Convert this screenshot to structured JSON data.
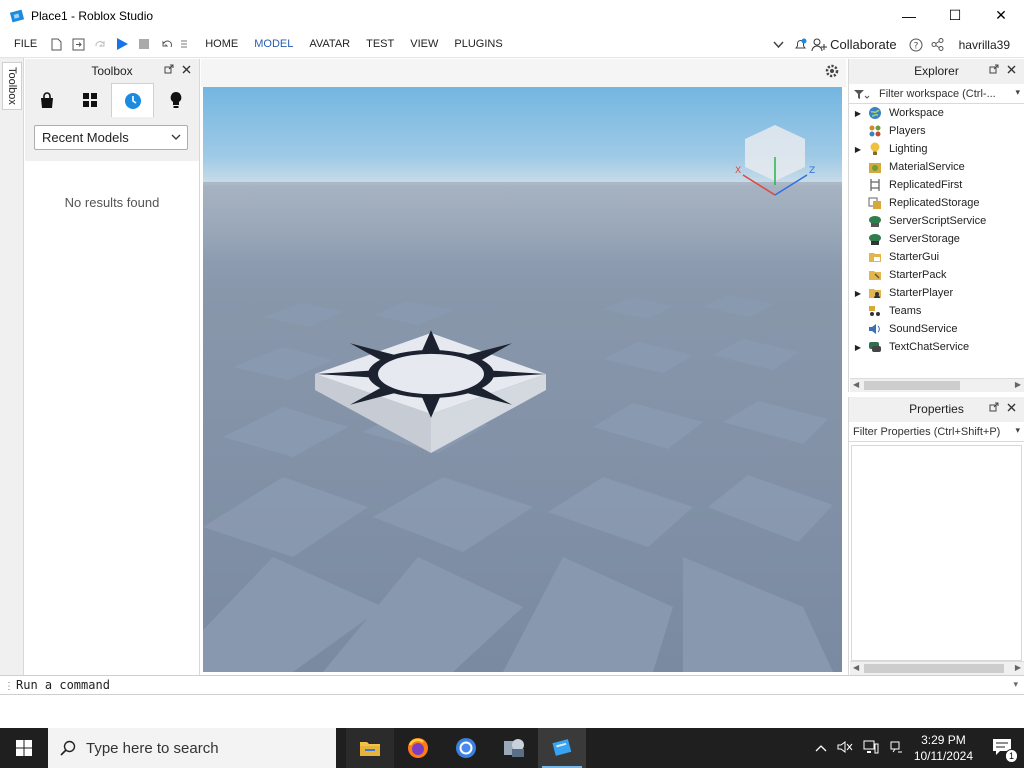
{
  "window": {
    "title": "Place1 - Roblox Studio",
    "minimize_glyph": "—",
    "maximize_glyph": "☐",
    "close_glyph": "✕"
  },
  "menubar": {
    "file": "FILE",
    "tabs": [
      "HOME",
      "MODEL",
      "AVATAR",
      "TEST",
      "VIEW",
      "PLUGINS"
    ],
    "active_tab": "MODEL",
    "collaborate": "Collaborate",
    "user": "havrilla39"
  },
  "left_strip": {
    "tab_label": "Toolbox"
  },
  "toolbox": {
    "title": "Toolbox",
    "tabs": [
      "marketplace",
      "inventory",
      "recent",
      "creations"
    ],
    "selected_tab": "recent",
    "dropdown_value": "Recent Models",
    "empty_message": "No results found"
  },
  "explorer": {
    "title": "Explorer",
    "filter_placeholder": "Filter workspace (Ctrl-...",
    "items": [
      {
        "label": "Workspace",
        "expandable": true,
        "icon": "workspace-icon",
        "color": "#3b82c4"
      },
      {
        "label": "Players",
        "expandable": false,
        "icon": "players-icon",
        "color": "#d08a2a"
      },
      {
        "label": "Lighting",
        "expandable": true,
        "icon": "lighting-icon",
        "color": "#e0b030"
      },
      {
        "label": "MaterialService",
        "expandable": false,
        "icon": "material-service-icon",
        "color": "#c98b2e"
      },
      {
        "label": "ReplicatedFirst",
        "expandable": false,
        "icon": "replicated-first-icon",
        "color": "#777777"
      },
      {
        "label": "ReplicatedStorage",
        "expandable": false,
        "icon": "replicated-storage-icon",
        "color": "#b8742a"
      },
      {
        "label": "ServerScriptService",
        "expandable": false,
        "icon": "server-script-service-icon",
        "color": "#2f7d4e"
      },
      {
        "label": "ServerStorage",
        "expandable": false,
        "icon": "server-storage-icon",
        "color": "#2f7d4e"
      },
      {
        "label": "StarterGui",
        "expandable": false,
        "icon": "starter-gui-icon",
        "color": "#d7a83a"
      },
      {
        "label": "StarterPack",
        "expandable": false,
        "icon": "starter-pack-icon",
        "color": "#d7a83a"
      },
      {
        "label": "StarterPlayer",
        "expandable": true,
        "icon": "starter-player-icon",
        "color": "#d7a83a"
      },
      {
        "label": "Teams",
        "expandable": false,
        "icon": "teams-icon",
        "color": "#c07a2a"
      },
      {
        "label": "SoundService",
        "expandable": false,
        "icon": "sound-service-icon",
        "color": "#3b6fb6"
      },
      {
        "label": "TextChatService",
        "expandable": true,
        "icon": "text-chat-service-icon",
        "color": "#2f6f4e"
      }
    ]
  },
  "properties": {
    "title": "Properties",
    "filter_placeholder": "Filter Properties (Ctrl+Shift+P)"
  },
  "command_bar": {
    "placeholder": "Run a command"
  },
  "taskbar": {
    "search_placeholder": "Type here to search",
    "apps": [
      "file-explorer",
      "firefox",
      "chrome",
      "app-4",
      "roblox-studio"
    ],
    "active_app": "roblox-studio",
    "time": "3:29 PM",
    "date": "10/11/2024",
    "notification_count": "1"
  },
  "colors": {
    "accent_blue": "#2a5db0",
    "play_blue": "#1a73e8",
    "toolbox_selected": "#1a8be0",
    "taskbar": "#1f1f1f"
  }
}
